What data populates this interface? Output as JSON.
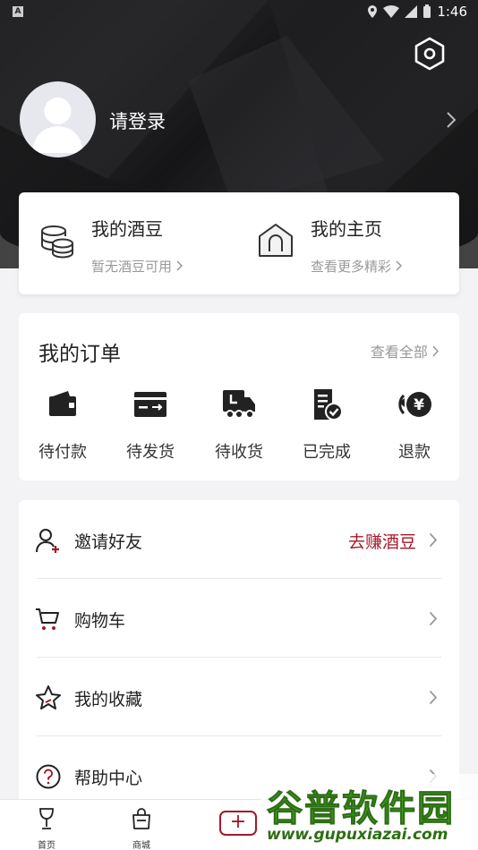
{
  "status_bar": {
    "time": "1:46",
    "badge": "A"
  },
  "header": {
    "login_text": "请登录"
  },
  "beans": {
    "left": {
      "title": "我的酒豆",
      "subtitle": "暂无酒豆可用"
    },
    "right": {
      "title": "我的主页",
      "subtitle": "查看更多精彩"
    }
  },
  "orders": {
    "title": "我的订单",
    "view_all": "查看全部",
    "items": [
      {
        "label": "待付款",
        "icon": "wallet-icon"
      },
      {
        "label": "待发货",
        "icon": "card-send-icon"
      },
      {
        "label": "待收货",
        "icon": "truck-icon"
      },
      {
        "label": "已完成",
        "icon": "doc-check-icon"
      },
      {
        "label": "退款",
        "icon": "refund-yen-icon"
      }
    ]
  },
  "menu": {
    "items": [
      {
        "label": "邀请好友",
        "right": "去赚酒豆",
        "icon": "invite-user-icon"
      },
      {
        "label": "购物车",
        "right": "",
        "icon": "cart-icon"
      },
      {
        "label": "我的收藏",
        "right": "",
        "icon": "star-icon"
      },
      {
        "label": "帮助中心",
        "right": "",
        "icon": "help-icon"
      }
    ]
  },
  "bottom_nav": {
    "items": [
      {
        "label": "首页",
        "icon": "wine-glass-icon"
      },
      {
        "label": "商城",
        "icon": "shopping-bag-icon"
      }
    ],
    "plus": "+"
  },
  "watermark": {
    "logo": "谷普软件园",
    "url": "www.gupuxiazai.com"
  },
  "colors": {
    "accent": "#a3192a",
    "header_dark": "#1c1c1e",
    "watermark_green": "#4aa82a"
  }
}
